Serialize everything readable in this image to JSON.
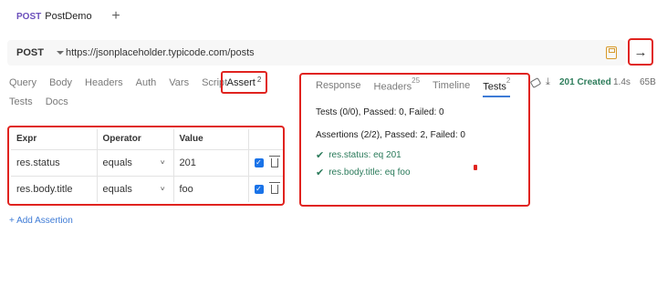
{
  "tab": {
    "method": "POST",
    "name": "PostDemo",
    "new_tab": "+"
  },
  "request": {
    "method": "POST",
    "url": "https://jsonplaceholder.typicode.com/posts",
    "send": "→"
  },
  "req_tabs": [
    "Query",
    "Body",
    "Headers",
    "Auth",
    "Vars",
    "Script"
  ],
  "assert_tab": {
    "label": "Assert",
    "count": "2"
  },
  "req_tabs2": [
    "Tests",
    "Docs"
  ],
  "assertions": {
    "headers": [
      "Expr",
      "Operator",
      "Value",
      ""
    ],
    "rows": [
      {
        "expr": "res.status",
        "operator": "equals",
        "value": "201",
        "enabled": true
      },
      {
        "expr": "res.body.title",
        "operator": "equals",
        "value": "foo",
        "enabled": true
      }
    ],
    "add_label": "+ Add Assertion"
  },
  "response": {
    "tabs": [
      {
        "label": "Response"
      },
      {
        "label": "Headers",
        "count": "25"
      },
      {
        "label": "Timeline"
      },
      {
        "label": "Tests",
        "count": "2",
        "active": true
      }
    ],
    "tests_summary": "Tests (0/0), Passed: 0, Failed: 0",
    "assertions_summary": "Assertions (2/2), Passed: 2, Failed: 0",
    "results": [
      "res.status: eq 201",
      "res.body.title: eq foo"
    ]
  },
  "status": {
    "code": "201 Created",
    "time": "1.4s",
    "size": "65B"
  },
  "colors": {
    "highlight": "#e0231f",
    "success": "#2e7d5b",
    "link": "#3e7bd6",
    "method": "#6b4fbb"
  }
}
